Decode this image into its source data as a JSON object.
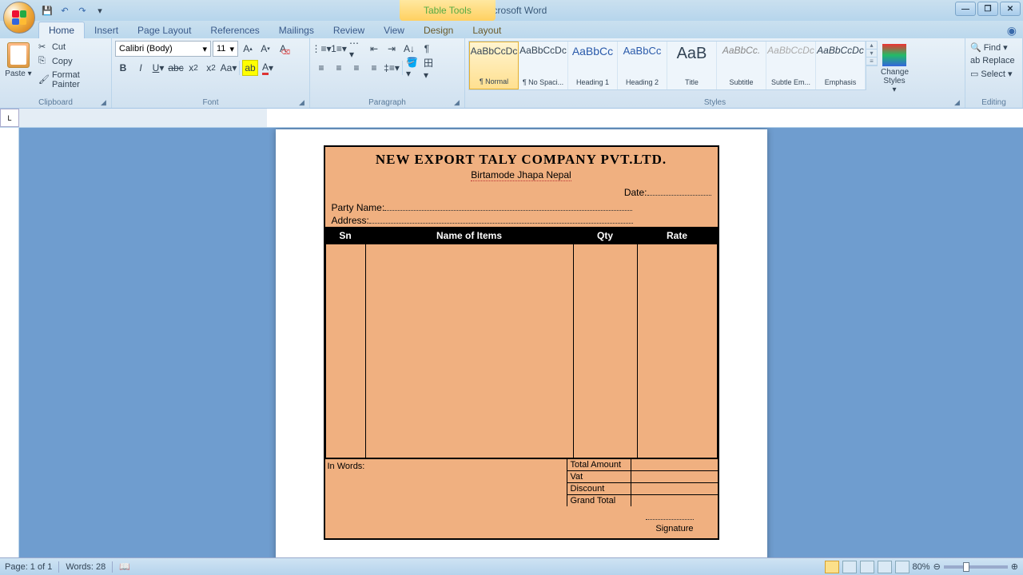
{
  "window": {
    "title": "Bill Design - Microsoft Word",
    "context_tab": "Table Tools"
  },
  "tabs": {
    "home": "Home",
    "insert": "Insert",
    "page_layout": "Page Layout",
    "references": "References",
    "mailings": "Mailings",
    "review": "Review",
    "view": "View",
    "design": "Design",
    "layout": "Layout"
  },
  "clipboard": {
    "paste": "Paste",
    "cut": "Cut",
    "copy": "Copy",
    "format_painter": "Format Painter",
    "label": "Clipboard"
  },
  "font": {
    "name": "Calibri (Body)",
    "size": "11",
    "label": "Font"
  },
  "paragraph": {
    "label": "Paragraph"
  },
  "styles": {
    "label": "Styles",
    "items": [
      {
        "preview": "AaBbCcDc",
        "name": "¶ Normal"
      },
      {
        "preview": "AaBbCcDc",
        "name": "¶ No Spaci..."
      },
      {
        "preview": "AaBbCc",
        "name": "Heading 1"
      },
      {
        "preview": "AaBbCc",
        "name": "Heading 2"
      },
      {
        "preview": "AaB",
        "name": "Title"
      },
      {
        "preview": "AaBbCc.",
        "name": "Subtitle"
      },
      {
        "preview": "AaBbCcDc",
        "name": "Subtle Em..."
      },
      {
        "preview": "AaBbCcDc",
        "name": "Emphasis"
      }
    ],
    "change": "Change Styles"
  },
  "editing": {
    "find": "Find",
    "replace": "Replace",
    "select": "Select",
    "label": "Editing"
  },
  "document": {
    "company": "NEW EXPORT TALY COMPANY PVT.LTD.",
    "address": "Birtamode Jhapa Nepal",
    "date_label": "Date:",
    "party_label": "Party Name:",
    "addr_label": "Address:",
    "cols": {
      "sn": "Sn",
      "name": "Name of Items",
      "qty": "Qty",
      "rate": "Rate"
    },
    "in_words": "In Words:",
    "totals": {
      "total": "Total Amount",
      "vat": "Vat",
      "discount": "Discount",
      "grand": "Grand Total"
    },
    "signature": "Signature"
  },
  "status": {
    "page": "Page: 1 of 1",
    "words": "Words: 28",
    "zoom": "80%"
  }
}
